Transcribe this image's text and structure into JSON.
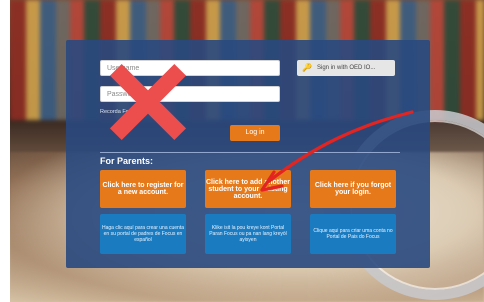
{
  "login": {
    "username_placeholder": "Username",
    "password_placeholder": "Password",
    "openid_label": "Sign in with OED IO...",
    "remember_text": "Recorda  Forgot Pa...",
    "login_label": "Log in"
  },
  "parents": {
    "heading": "For Parents:",
    "actions": [
      {
        "label": "Click here to register for a new account."
      },
      {
        "label": "Click here to add another student to your existing account."
      },
      {
        "label": "Click here if you forgot your login."
      }
    ],
    "translations": [
      {
        "label": "Haga clic aquí para crear una cuenta en su portal de padres de Focus en español"
      },
      {
        "label": "Klike isit la pou kreye kont Portal Paran Focus ou pa nan lang kreyòl ayisyen"
      },
      {
        "label": "Clique aqui para criar uma conta no Portal de Pais do Focus"
      }
    ]
  },
  "overlay": {
    "x_color": "#ec4d4d",
    "arrow_color": "#e32420"
  }
}
